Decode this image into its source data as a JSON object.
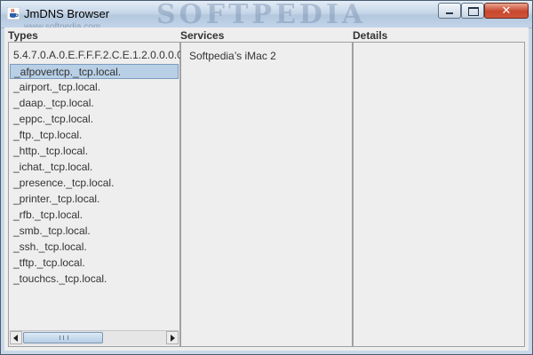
{
  "window": {
    "title": "JmDNS Browser",
    "watermark": "SOFTPEDIA",
    "watermark_url": "www.softpedia.com",
    "close_label": "✕"
  },
  "columns": {
    "types_header": "Types",
    "services_header": "Services",
    "details_header": "Details"
  },
  "types": {
    "items": [
      "5.4.7.0.A.0.E.F.F.F.2.C.E.1.2.0.0.0.0",
      "_afpovertcp._tcp.local.",
      "_airport._tcp.local.",
      "_daap._tcp.local.",
      "_eppc._tcp.local.",
      "_ftp._tcp.local.",
      "_http._tcp.local.",
      "_ichat._tcp.local.",
      "_presence._tcp.local.",
      "_printer._tcp.local.",
      "_rfb._tcp.local.",
      "_smb._tcp.local.",
      "_ssh._tcp.local.",
      "_tftp._tcp.local.",
      "_touchcs._tcp.local."
    ],
    "selected": "_afpovertcp._tcp.local."
  },
  "services": {
    "items": [
      "Softpedia’s iMac 2"
    ]
  },
  "colors": {
    "selection_bg": "#b8cfe5",
    "selection_border": "#7a9cc0",
    "close_button": "#c8462d"
  },
  "icons": {
    "app": "java-cup-icon",
    "minimize": "minimize-icon",
    "maximize": "maximize-icon",
    "close": "close-icon"
  }
}
